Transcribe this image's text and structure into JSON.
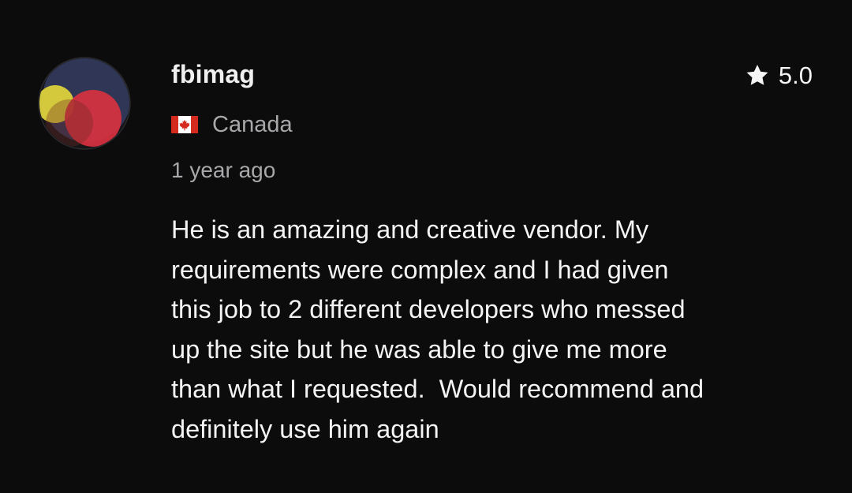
{
  "review": {
    "username": "fbimag",
    "rating": "5.0",
    "country": "Canada",
    "country_flag_icon": "canada-flag-icon",
    "time_ago": "1 year ago",
    "text": "He is an amazing and creative vendor. My\nrequirements were complex and I had given\nthis job to 2 different developers who messed\nup the site but he was able to give me more\nthan what I requested.  Would recommend and\ndefinitely use him again"
  },
  "colors": {
    "background": "#0c0c0d",
    "primary_text": "#f2f2f2",
    "secondary_text": "#a8a8aa",
    "avatar_navy": "#2f3656",
    "avatar_yellow": "#d4c93c",
    "avatar_red": "#d8313f"
  },
  "icons": {
    "rating": "star-icon",
    "avatar": "avatar-circles-icon"
  }
}
